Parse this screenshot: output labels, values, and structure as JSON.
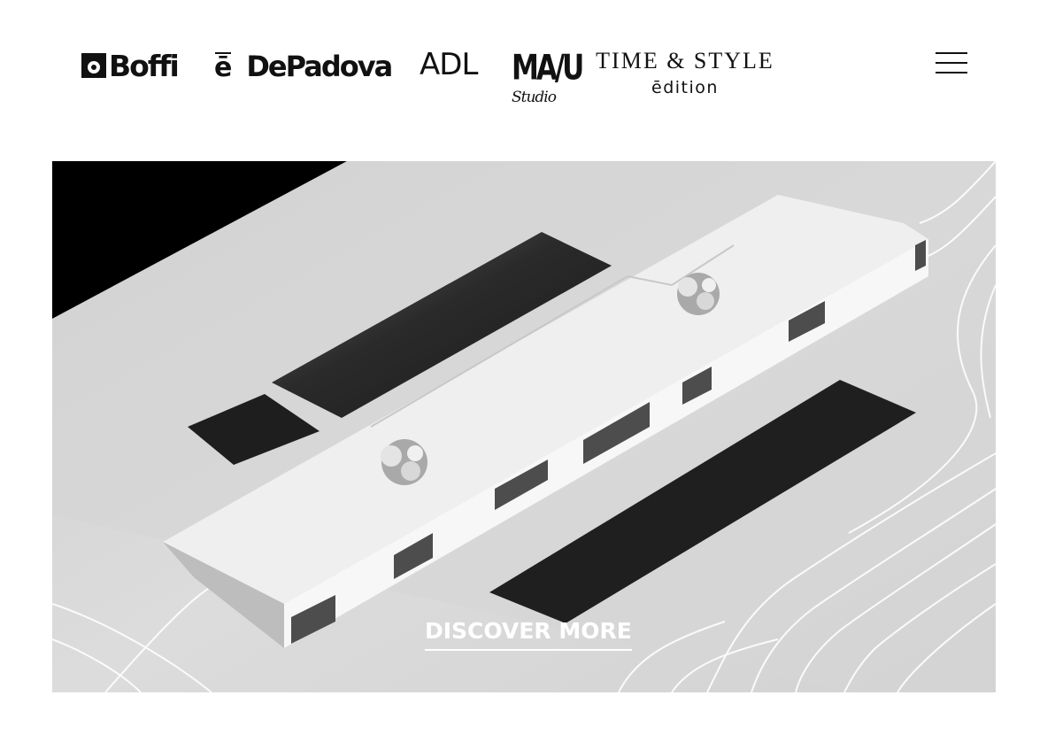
{
  "header": {
    "brands": [
      {
        "label": "Boffi"
      },
      {
        "mark": "ē",
        "label": "DePadova"
      },
      {
        "label": "ADL"
      },
      {
        "label": "MA/U",
        "sub": "Studio"
      },
      {
        "label": "TIME & STYLE",
        "sub": "ēdition"
      }
    ],
    "menu_icon": "hamburger-menu-icon"
  },
  "hero": {
    "image": "grayscale architectural model of a long flat-roofed house with pools and contour-line terrain",
    "cta_label": "DISCOVER MORE",
    "cta_color": "#ffffff"
  }
}
